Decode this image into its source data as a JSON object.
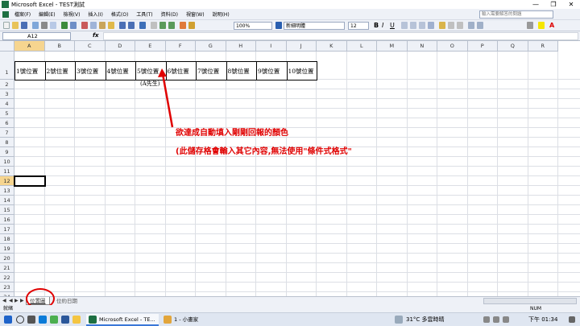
{
  "window": {
    "title": "Microsoft Excel - TEST測試",
    "buttons": [
      "—",
      "❐",
      "✕"
    ]
  },
  "menu": {
    "items": [
      "檔案(F)",
      "編輯(E)",
      "檢視(V)",
      "插入(I)",
      "格式(O)",
      "工具(T)",
      "資料(D)",
      "視窗(W)",
      "說明(H)"
    ],
    "help_placeholder": "輸入需要解答的問題"
  },
  "toolbar": {
    "zoom": "100%",
    "font": "新細明體",
    "font_size": "12"
  },
  "formula_bar": {
    "name_box": "A12",
    "fx_label": "fx",
    "value": ""
  },
  "grid": {
    "columns": [
      "A",
      "B",
      "C",
      "D",
      "E",
      "F",
      "G",
      "H",
      "I",
      "J",
      "K",
      "L",
      "M",
      "N",
      "O",
      "P",
      "Q",
      "R"
    ],
    "rows": [
      "1",
      "2",
      "3",
      "4",
      "5",
      "6",
      "7",
      "8",
      "9",
      "10",
      "11",
      "12",
      "13",
      "14",
      "15",
      "16",
      "17",
      "18",
      "19",
      "20",
      "21",
      "22",
      "23",
      "24"
    ],
    "selected_cell": "A12",
    "row1_cells": [
      "1號位置",
      "2號位置",
      "3號位置",
      "4號位置",
      "5號位置",
      "6號位置",
      "7號位置",
      "8號位置",
      "9號位置",
      "10號位置"
    ],
    "note_under_e": "(A先生)"
  },
  "annotation": {
    "line1": "欲達成自動填入剛剛回報的顏色",
    "line2": "(此儲存格會輸入其它內容,無法使用\"條件式格式\"",
    "color": "#e00000"
  },
  "sheet_tabs": {
    "tabs": [
      "位置圖",
      "位約日期"
    ],
    "active": "位置圖"
  },
  "status": {
    "ready": "就緒",
    "num": "NUM"
  },
  "taskbar": {
    "tasks": [
      "Microsoft Excel - TE...",
      "1 - 小畫家"
    ],
    "weather": "31°C 多雲時晴",
    "time": "下午 01:34"
  }
}
